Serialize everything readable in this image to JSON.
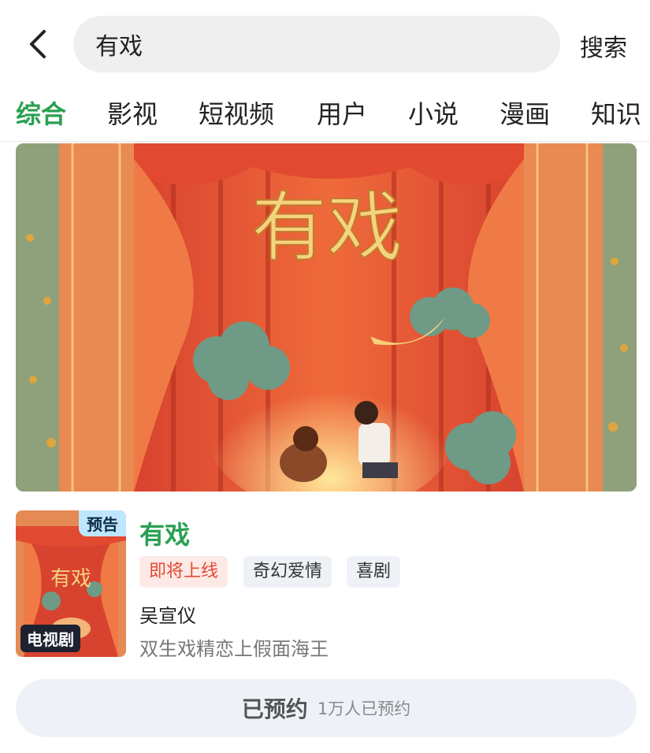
{
  "search": {
    "query": "有戏",
    "button_label": "搜索"
  },
  "tabs": [
    {
      "label": "综合",
      "active": true
    },
    {
      "label": "影视",
      "active": false
    },
    {
      "label": "短视频",
      "active": false
    },
    {
      "label": "用户",
      "active": false
    },
    {
      "label": "小说",
      "active": false
    },
    {
      "label": "漫画",
      "active": false
    },
    {
      "label": "知识",
      "active": false
    }
  ],
  "poster": {
    "title_art": "有戏"
  },
  "result": {
    "badge_preview": "预告",
    "badge_type": "电视剧",
    "title": "有戏",
    "tags": [
      "即将上线",
      "奇幻爱情",
      "喜剧"
    ],
    "cast": "吴宣仪",
    "description": "双生戏精恋上假面海王"
  },
  "reserve": {
    "label": "已预约",
    "count_text": "1万人已预约"
  },
  "colors": {
    "accent": "#2aa052",
    "tag_soon": "#e24b33",
    "curtain": "#d8432f"
  }
}
